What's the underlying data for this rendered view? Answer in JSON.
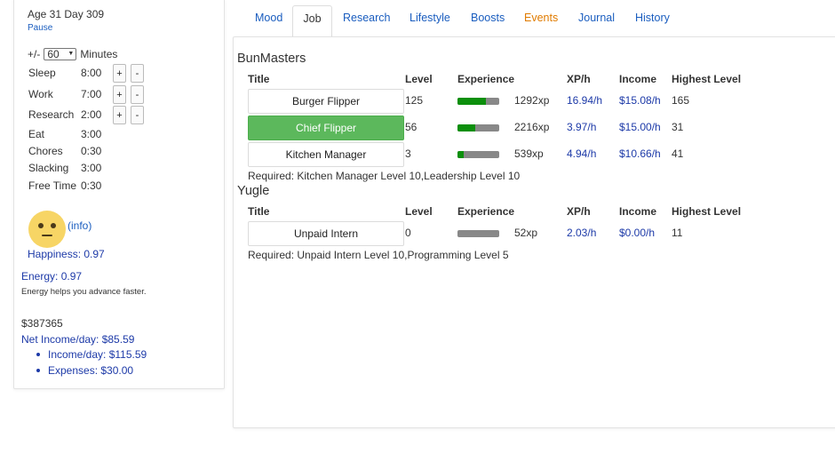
{
  "status": {
    "age_line": "Age 31 Day 309",
    "pause_label": "Pause"
  },
  "schedule": {
    "step_prefix": "+/-",
    "step_value": "60",
    "step_unit": "Minutes",
    "rows": [
      {
        "label": "Sleep",
        "time": "8:00",
        "adjustable": true
      },
      {
        "label": "Work",
        "time": "7:00",
        "adjustable": true
      },
      {
        "label": "Research",
        "time": "2:00",
        "adjustable": true
      },
      {
        "label": "Eat",
        "time": "3:00",
        "adjustable": false
      },
      {
        "label": "Chores",
        "time": "0:30",
        "adjustable": false
      },
      {
        "label": "Slacking",
        "time": "3:00",
        "adjustable": false
      },
      {
        "label": "Free Time",
        "time": "0:30",
        "adjustable": false
      }
    ],
    "plus_label": "+",
    "minus_label": "-"
  },
  "mood": {
    "icon": "neutral-face-icon",
    "face_color": "#f7d565",
    "info_label": "(info)",
    "happiness": "Happiness: 0.97",
    "energy": "Energy: 0.97",
    "energy_note": "Energy helps you advance faster."
  },
  "finance": {
    "money": "$387365",
    "net_income": "Net Income/day: $85.59",
    "income": "Income/day: $115.59",
    "expenses": "Expenses: $30.00"
  },
  "tabs": [
    {
      "label": "Mood",
      "active": false,
      "color": "#1a5dbf"
    },
    {
      "label": "Job",
      "active": true,
      "color": "#333333"
    },
    {
      "label": "Research",
      "active": false,
      "color": "#1a5dbf"
    },
    {
      "label": "Lifestyle",
      "active": false,
      "color": "#1a5dbf"
    },
    {
      "label": "Boosts",
      "active": false,
      "color": "#1a5dbf"
    },
    {
      "label": "Events",
      "active": false,
      "color": "#e07b00"
    },
    {
      "label": "Journal",
      "active": false,
      "color": "#1a5dbf"
    },
    {
      "label": "History",
      "active": false,
      "color": "#1a5dbf"
    }
  ],
  "job_table": {
    "headers": {
      "title": "Title",
      "level": "Level",
      "experience": "Experience",
      "xph": "XP/h",
      "income": "Income",
      "highest": "Highest Level"
    }
  },
  "companies": [
    {
      "name": "BunMasters",
      "jobs": [
        {
          "title": "Burger Flipper",
          "level": "125",
          "xp_progress": 0.68,
          "xp": "1292xp",
          "xph": "16.94/h",
          "income": "$15.08/h",
          "highest": "165",
          "current": false
        },
        {
          "title": "Chief Flipper",
          "level": "56",
          "xp_progress": 0.42,
          "xp": "2216xp",
          "xph": "3.97/h",
          "income": "$15.00/h",
          "highest": "31",
          "current": true
        },
        {
          "title": "Kitchen Manager",
          "level": "3",
          "xp_progress": 0.14,
          "xp": "539xp",
          "xph": "4.94/h",
          "income": "$10.66/h",
          "highest": "41",
          "current": false
        }
      ],
      "required": "Required: Kitchen Manager Level 10,Leadership Level 10"
    },
    {
      "name": "Yugle",
      "jobs": [
        {
          "title": "Unpaid Intern",
          "level": "0",
          "xp_progress": 0.0,
          "xp": "52xp",
          "xph": "2.03/h",
          "income": "$0.00/h",
          "highest": "11",
          "current": false
        }
      ],
      "required": "Required: Unpaid Intern Level 10,Programming Level 5"
    }
  ],
  "colors": {
    "link": "#1a5dbf",
    "stat_blue": "#1d3aa8",
    "current_job": "#5cb85c",
    "xp_fill": "#0c8f0c",
    "xp_track": "#888888",
    "events_tab": "#e07b00"
  }
}
